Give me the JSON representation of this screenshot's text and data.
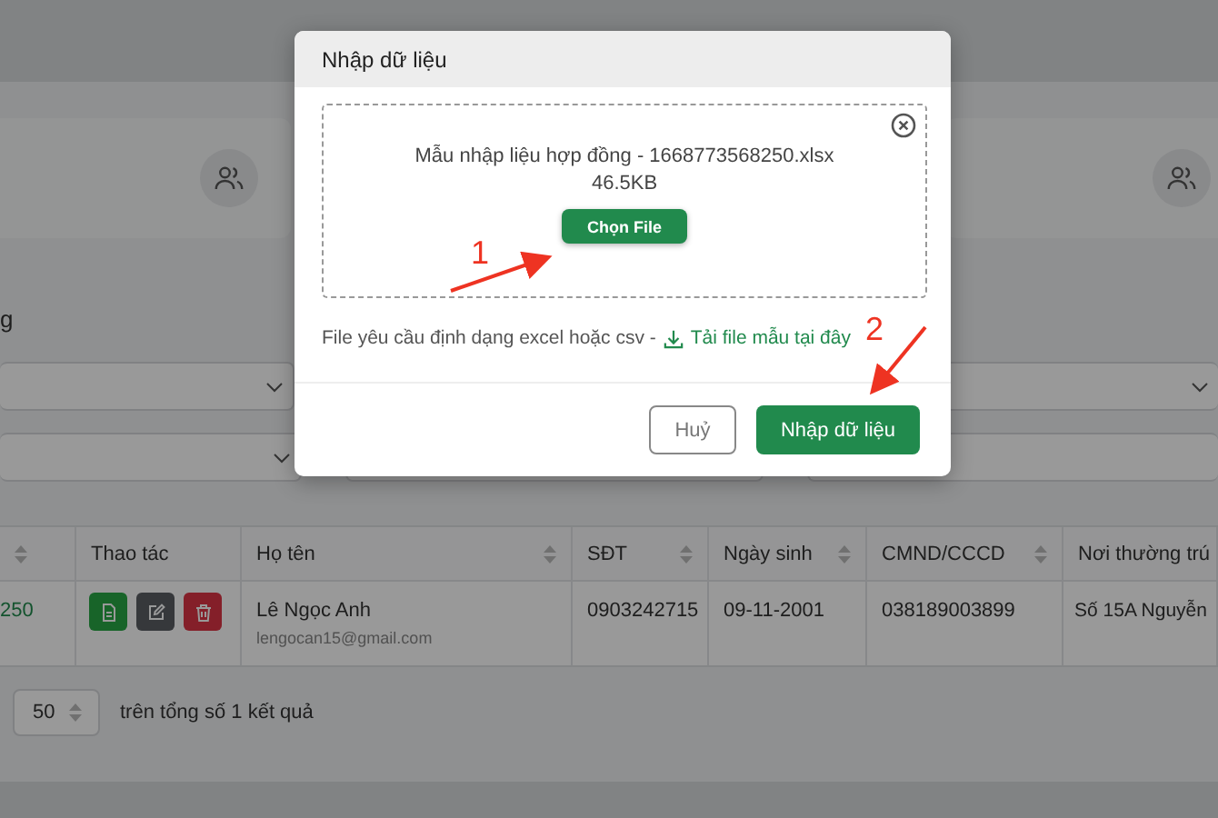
{
  "page": {
    "section_heading": "g"
  },
  "table": {
    "lead_column": {
      "sortable": true
    },
    "columns": [
      {
        "label": "Thao tác",
        "sortable": false
      },
      {
        "label": "Họ tên",
        "sortable": true
      },
      {
        "label": "SĐT",
        "sortable": true
      },
      {
        "label": "Ngày sinh",
        "sortable": true
      },
      {
        "label": "CMND/CCCD",
        "sortable": true
      },
      {
        "label": "Nơi thường trú",
        "sortable": false
      }
    ],
    "rows": [
      {
        "column_1": "250",
        "actions": [
          {
            "kind": "view"
          },
          {
            "kind": "edit"
          },
          {
            "kind": "delete"
          }
        ],
        "name": "Lê Ngọc Anh",
        "email": "lengocan15@gmail.com",
        "phone": "0903242715",
        "birth_date": "09-11-2001",
        "id_number": "038189003899",
        "address": "Số 15A Nguyễn"
      }
    ]
  },
  "pagination": {
    "page_size": "50",
    "summary": "trên tổng số 1 kết quả"
  },
  "modal": {
    "title": "Nhập dữ liệu",
    "file_name": "Mẫu nhập liệu hợp đồng - 1668773568250.xlsx",
    "file_size": "46.5KB",
    "choose_button": "Chọn File",
    "note": "File yêu cầu định dạng excel hoặc csv -",
    "template_link": "Tải file mẫu tại đây",
    "cancel_button": "Huỷ",
    "submit_button": "Nhập dữ liệu"
  },
  "annotations": [
    {
      "label": "1"
    },
    {
      "label": "2"
    }
  ]
}
